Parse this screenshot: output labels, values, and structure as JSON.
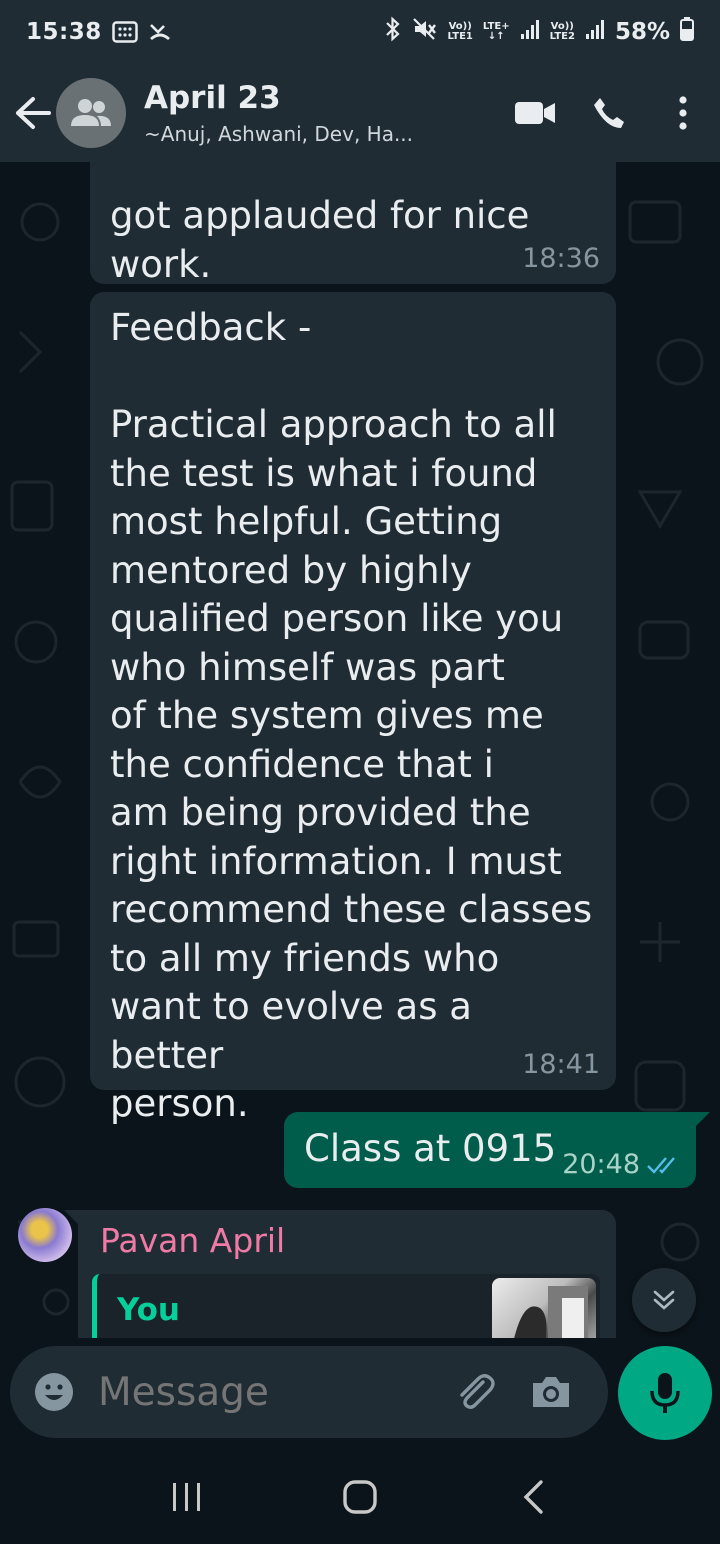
{
  "status_bar": {
    "time": "15:38",
    "net1_top": "Vo))",
    "net1_bottom": "LTE1",
    "net2_top": "LTE+",
    "net2_bottom": "↓↑",
    "net3_top": "Vo))",
    "net3_bottom": "LTE2",
    "battery": "58%"
  },
  "header": {
    "title": "April 23",
    "subtitle": "~Anuj, Ashwani, Dev, Ha..."
  },
  "messages": [
    {
      "text": "got applauded for nice\nwork.",
      "time": "18:36",
      "direction": "incoming"
    },
    {
      "text": "Feedback -\n\nPractical approach to all\nthe test is what i found\nmost helpful. Getting\nmentored by highly\nqualified person like you\nwho himself was part\nof the system gives me\nthe confidence that i\nam being provided the\nright information. I must\nrecommend these classes\nto all my friends who\nwant to evolve as a better\nperson.",
      "time": "18:41",
      "direction": "incoming"
    },
    {
      "text": "Class at 0915",
      "time": "20:48",
      "direction": "outgoing",
      "status": "read"
    },
    {
      "sender": "Pavan April",
      "quote_author": "You",
      "direction": "incoming"
    }
  ],
  "composer": {
    "placeholder": "Message"
  },
  "colors": {
    "background": "#0b141a",
    "bar": "#1f2c34",
    "incoming_bubble": "#202c33",
    "outgoing_bubble": "#005c4b",
    "accent": "#00a884",
    "sender_name": "#ef7aa5",
    "read_ticks": "#53bdeb"
  }
}
